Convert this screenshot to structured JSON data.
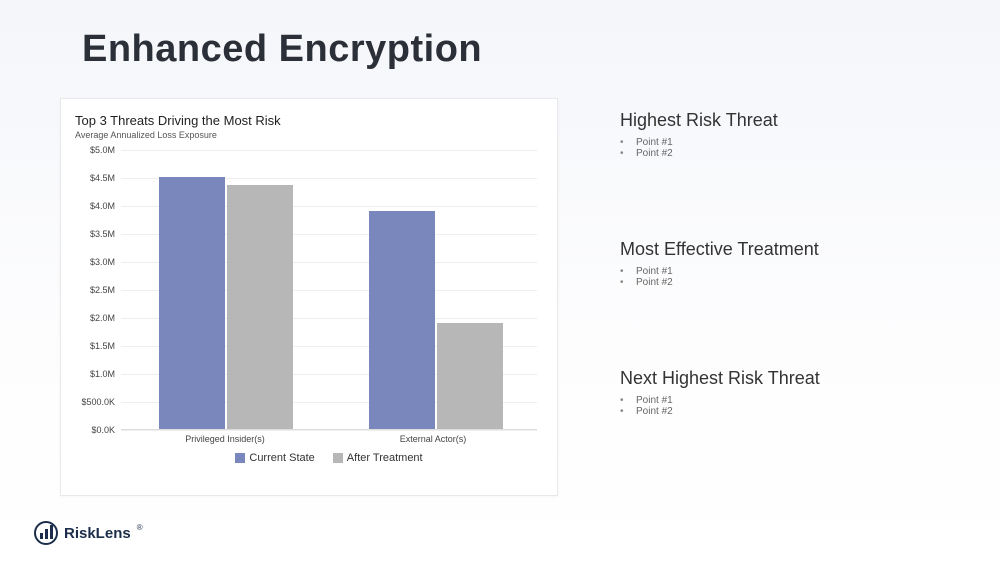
{
  "title": "Enhanced Encryption",
  "chart_data": {
    "type": "bar",
    "title": "Top 3 Threats Driving the Most Risk",
    "subtitle": "Average Annualized Loss Exposure",
    "ylabel": "",
    "xlabel": "",
    "ylim": [
      0,
      5000000
    ],
    "y_ticks": [
      "$0.0K",
      "$500.0K",
      "$1.0M",
      "$1.5M",
      "$2.0M",
      "$2.5M",
      "$3.0M",
      "$3.5M",
      "$4.0M",
      "$4.5M",
      "$5.0M"
    ],
    "categories": [
      "Privileged Insider(s)",
      "External Actor(s)"
    ],
    "series": [
      {
        "name": "Current State",
        "values": [
          4500000,
          3900000
        ],
        "color": "#7a87bd"
      },
      {
        "name": "After Treatment",
        "values": [
          4350000,
          1900000
        ],
        "color": "#b7b7b7"
      }
    ]
  },
  "rhs": [
    {
      "heading": "Highest Risk Threat",
      "points": [
        "Point #1",
        "Point #2"
      ]
    },
    {
      "heading": "Most Effective Treatment",
      "points": [
        "Point #1",
        "Point #2"
      ]
    },
    {
      "heading": "Next Highest Risk Threat",
      "points": [
        "Point #1",
        "Point #2"
      ]
    }
  ],
  "brand": {
    "name": "RiskLens"
  }
}
